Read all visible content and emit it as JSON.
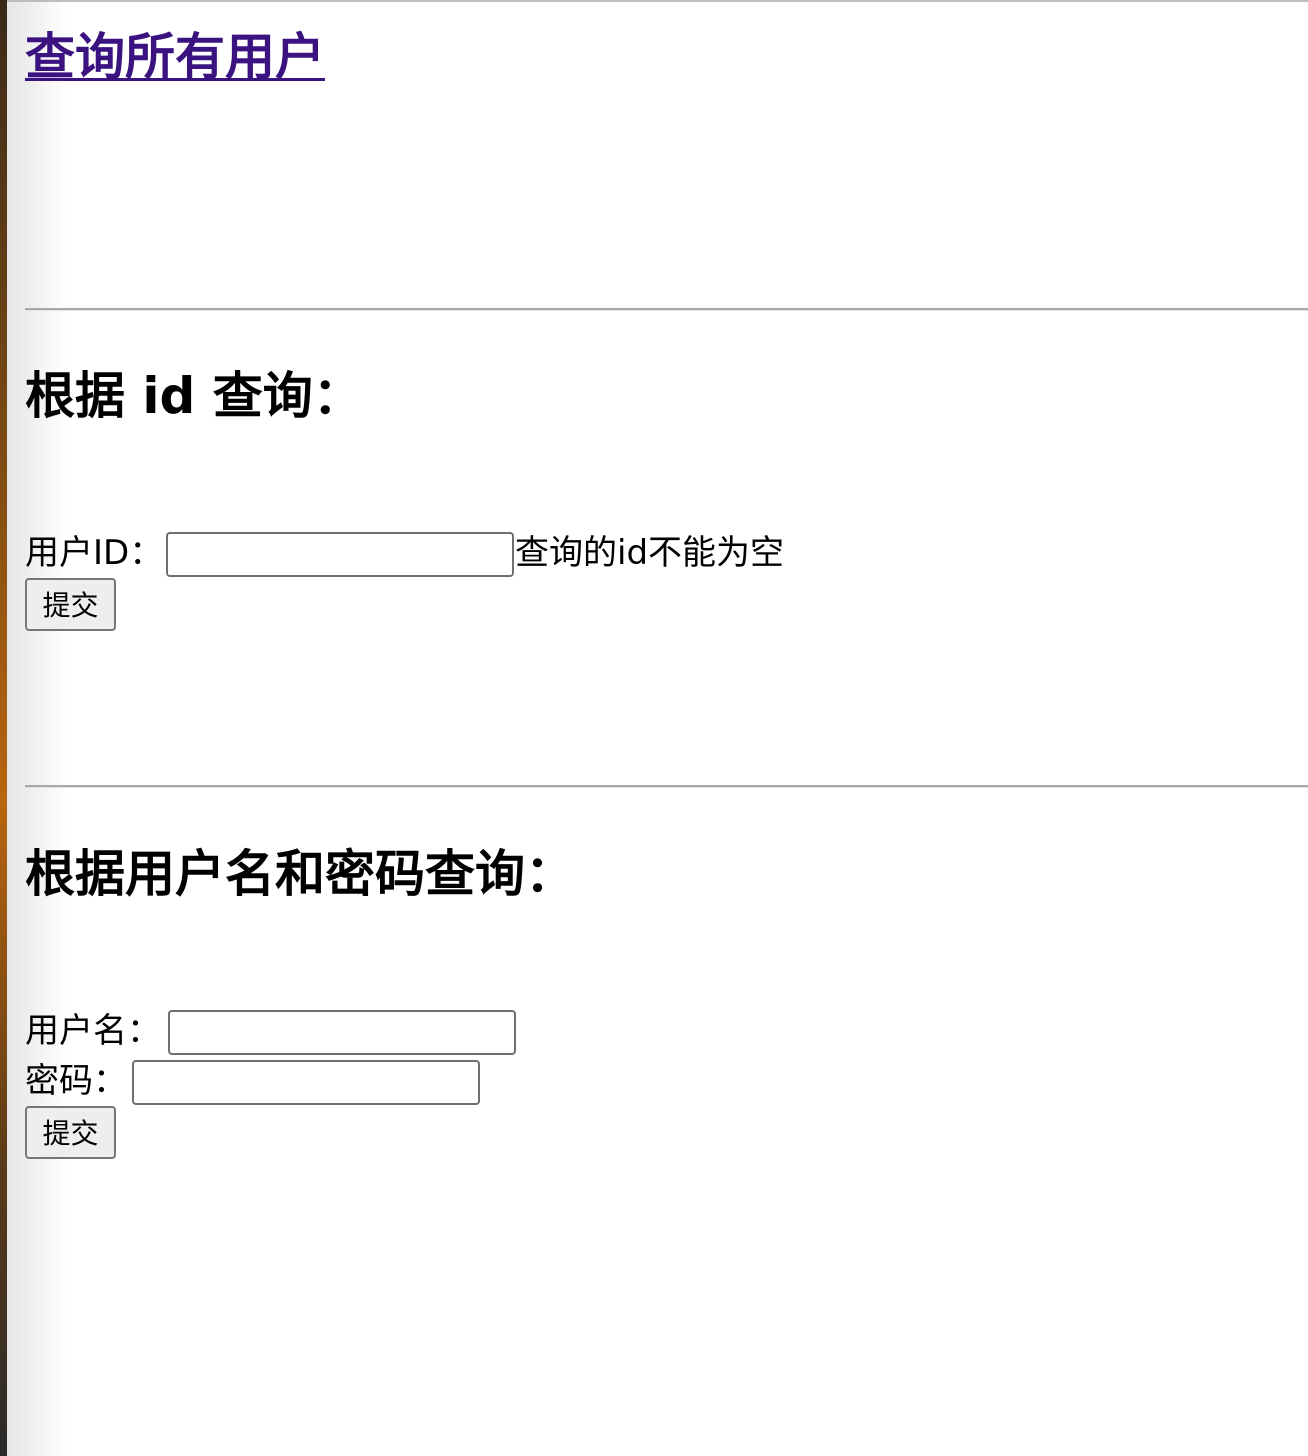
{
  "nav": {
    "query_all_link": "查询所有用户"
  },
  "section_id": {
    "heading": "根据 id 查询：",
    "user_id_label": "用户ID：",
    "user_id_value": "",
    "error_message": "查询的id不能为空",
    "submit_label": "提交"
  },
  "section_login": {
    "heading": "根据用户名和密码查询：",
    "username_label": "用户名：",
    "username_value": "",
    "password_label": "密码：",
    "password_value": "",
    "submit_label": "提交"
  },
  "colors": {
    "visited_link": "#3b1380",
    "rule": "#a8a8a8"
  }
}
